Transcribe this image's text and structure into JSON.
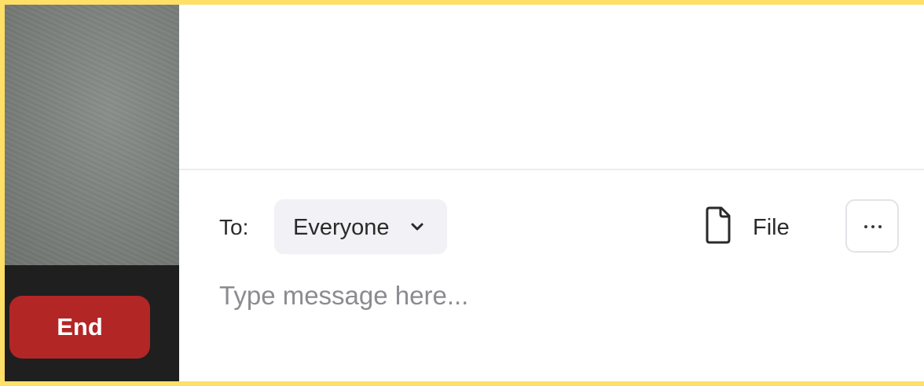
{
  "meeting_controls": {
    "end_label": "End",
    "end_color": "#b32626"
  },
  "chat": {
    "to_label": "To:",
    "recipient": "Everyone",
    "file_label": "File",
    "message_placeholder": "Type message here...",
    "message_value": ""
  },
  "icons": {
    "recipient_dropdown": "chevron-down-icon",
    "file": "file-icon",
    "more": "more-options-icon"
  }
}
